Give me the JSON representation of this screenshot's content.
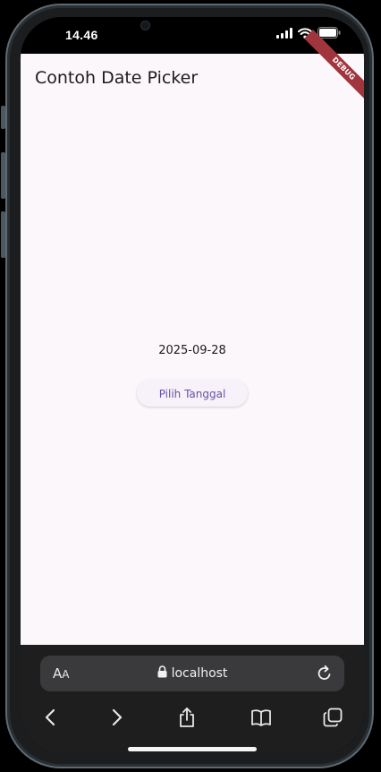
{
  "status_bar": {
    "time": "14.46"
  },
  "app": {
    "title": "Contoh Date Picker",
    "debug_banner": "DEBUG",
    "selected_date": "2025-09-28",
    "pick_button_label": "Pilih Tanggal"
  },
  "browser": {
    "text_size_label_large": "A",
    "text_size_label_small": "A",
    "url": "localhost"
  },
  "colors": {
    "app_background": "#fcf7fb",
    "accent": "#6750a4",
    "debug_banner": "#a0353d",
    "browser_chrome": "#1e1e1f",
    "url_bar": "#3a3a3c"
  },
  "icons": {
    "status": [
      "signal-icon",
      "wifi-icon",
      "battery-icon"
    ],
    "url_bar": [
      "lock-icon",
      "reload-icon"
    ],
    "toolbar": [
      "back-icon",
      "forward-icon",
      "share-icon",
      "bookmarks-icon",
      "tabs-icon"
    ]
  }
}
